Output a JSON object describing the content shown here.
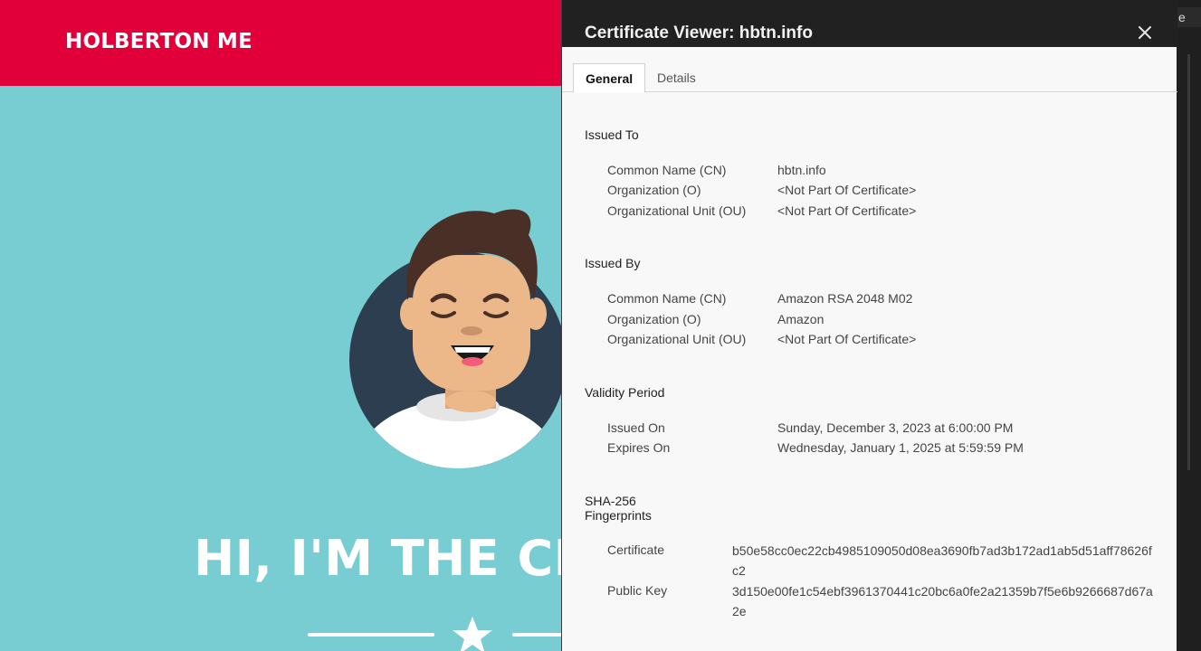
{
  "page": {
    "brand": "HOLBERTON ME",
    "hero_title": "HI, I'M THE CH"
  },
  "browser": {
    "tab_fragment": "e"
  },
  "certificate_viewer": {
    "title": "Certificate Viewer: hbtn.info",
    "tabs": [
      {
        "label": "General",
        "active": true
      },
      {
        "label": "Details",
        "active": false
      }
    ],
    "issued_to": {
      "heading": "Issued To",
      "rows": [
        {
          "label": "Common Name (CN)",
          "value": "hbtn.info"
        },
        {
          "label": "Organization (O)",
          "value": "<Not Part Of Certificate>"
        },
        {
          "label": "Organizational Unit (OU)",
          "value": "<Not Part Of Certificate>"
        }
      ]
    },
    "issued_by": {
      "heading": "Issued By",
      "rows": [
        {
          "label": "Common Name (CN)",
          "value": "Amazon RSA 2048 M02"
        },
        {
          "label": "Organization (O)",
          "value": "Amazon"
        },
        {
          "label": "Organizational Unit (OU)",
          "value": "<Not Part Of Certificate>"
        }
      ]
    },
    "validity": {
      "heading": "Validity Period",
      "rows": [
        {
          "label": "Issued On",
          "value": "Sunday, December 3, 2023 at 6:00:00 PM"
        },
        {
          "label": "Expires On",
          "value": "Wednesday, January 1, 2025 at 5:59:59 PM"
        }
      ]
    },
    "fingerprints": {
      "heading_line1": "SHA-256",
      "heading_line2": "Fingerprints",
      "rows": [
        {
          "label": "Certificate",
          "value": "b50e58cc0ec22cb4985109050d08ea3690fb7ad3b172ad1ab5d51aff78626fc2"
        },
        {
          "label": "Public Key",
          "value": "3d150e00fe1c54ebf3961370441c20bc6a0fe2a21359b7f5e6b9266687d67a2e"
        }
      ]
    }
  },
  "colors": {
    "brand_red": "#e2003b",
    "hero_teal": "#78cdd2",
    "dialog_header": "#212121"
  }
}
